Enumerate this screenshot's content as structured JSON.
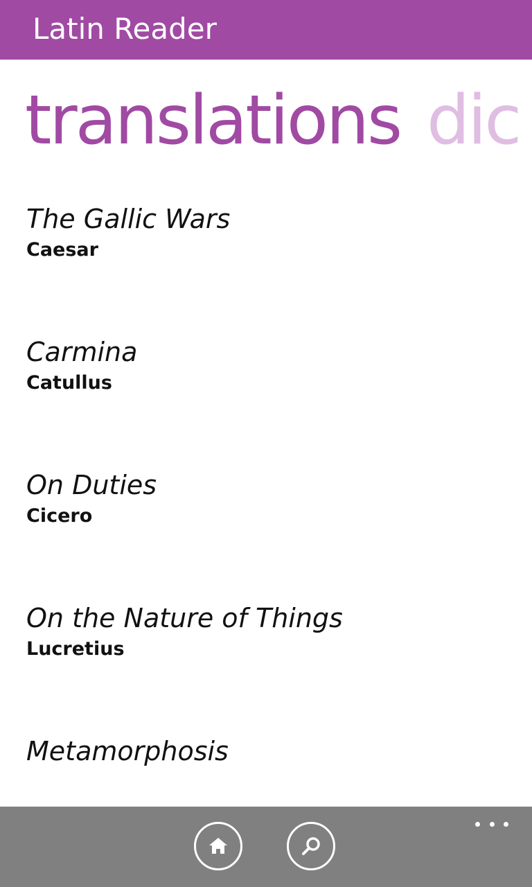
{
  "app": {
    "title": "Latin Reader"
  },
  "pivot": {
    "active": "translations",
    "next_partial": "dic"
  },
  "translations": [
    {
      "title": "The Gallic Wars",
      "author": "Caesar"
    },
    {
      "title": "Carmina",
      "author": "Catullus"
    },
    {
      "title": "On Duties",
      "author": "Cicero"
    },
    {
      "title": "On the Nature of Things",
      "author": "Lucretius"
    },
    {
      "title": "Metamorphosis",
      "author": ""
    }
  ],
  "appbar": {
    "buttons": [
      {
        "icon": "home-icon"
      },
      {
        "icon": "search-icon"
      }
    ],
    "more_icon": "ellipsis-icon"
  },
  "colors": {
    "accent": "#a04aa3",
    "accent_light": "#e0bde2",
    "appbar": "#808080"
  }
}
